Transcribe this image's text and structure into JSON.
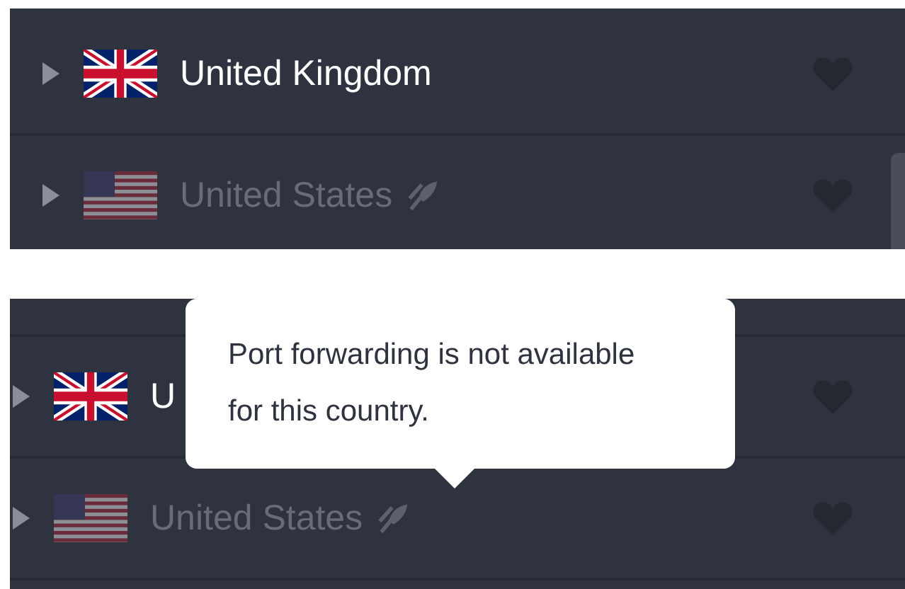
{
  "panels": [
    {
      "rows": [
        {
          "country": "United Kingdom",
          "kind": "uk",
          "disabled": false
        },
        {
          "country": "United States",
          "kind": "us",
          "disabled": true,
          "port_forwarding": false
        }
      ]
    },
    {
      "rows": [
        {
          "country": "U",
          "kind": "uk",
          "disabled": false
        },
        {
          "country": "United States",
          "kind": "us",
          "disabled": true,
          "port_forwarding": false
        }
      ],
      "tooltip": {
        "text": "Port forwarding is not available for this country."
      }
    }
  ]
}
